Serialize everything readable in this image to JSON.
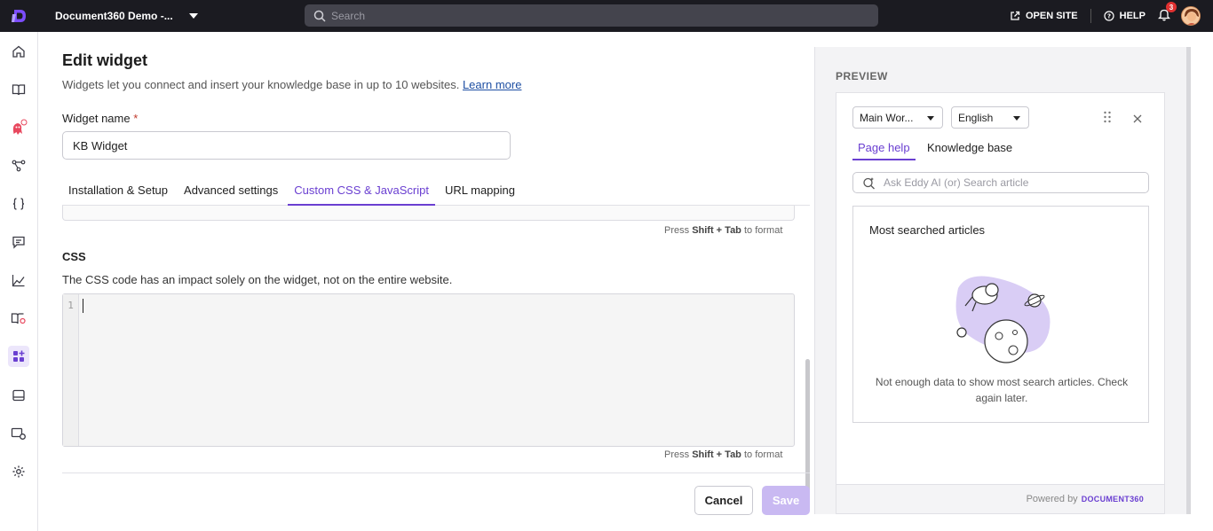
{
  "topbar": {
    "project_name": "Document360 Demo -...",
    "search_placeholder": "Search",
    "open_site_label": "OPEN SITE",
    "help_label": "HELP",
    "notification_count": "3"
  },
  "leftnav": {
    "items": [
      "home-icon",
      "book-icon",
      "eddy-ai-icon",
      "workflow-icon",
      "api-braces-icon",
      "comments-icon",
      "analytics-icon",
      "knowledge-base-icon",
      "widgets-icon",
      "layout-icon",
      "portal-settings-icon",
      "settings-gear-icon"
    ],
    "active": "widgets-icon"
  },
  "main": {
    "title": "Edit widget",
    "subtitle": "Widgets let you connect and insert your knowledge base in up to 10 websites.",
    "learn_more": "Learn more",
    "name_label": "Widget name",
    "required_mark": "*",
    "name_value": "KB Widget",
    "tabs": [
      {
        "label": "Installation & Setup",
        "active": false
      },
      {
        "label": "Advanced settings",
        "active": false
      },
      {
        "label": "Custom CSS & JavaScript",
        "active": true
      },
      {
        "label": "URL mapping",
        "active": false
      }
    ],
    "format_hint_press": "Press",
    "format_hint_keys": "Shift + Tab",
    "format_hint_to": "to format",
    "css_title": "CSS",
    "css_desc": "The CSS code has an impact solely on the widget, not on the entire website.",
    "line_number": "1",
    "cancel_label": "Cancel",
    "save_label": "Save"
  },
  "preview": {
    "label": "PREVIEW",
    "workspace_select": "Main Wor...",
    "language_select": "English",
    "tab_page_help": "Page help",
    "tab_knowledge_base": "Knowledge base",
    "search_placeholder": "Ask Eddy AI (or) Search article",
    "box_title": "Most searched articles",
    "empty_text": "Not enough data to show most search articles. Check again later.",
    "powered_by": "Powered by",
    "brand": "DOCUMENT360"
  },
  "colors": {
    "accent": "#6a3fd1",
    "topbar": "#1b1b21",
    "save_disabled": "#c9b9f2"
  }
}
